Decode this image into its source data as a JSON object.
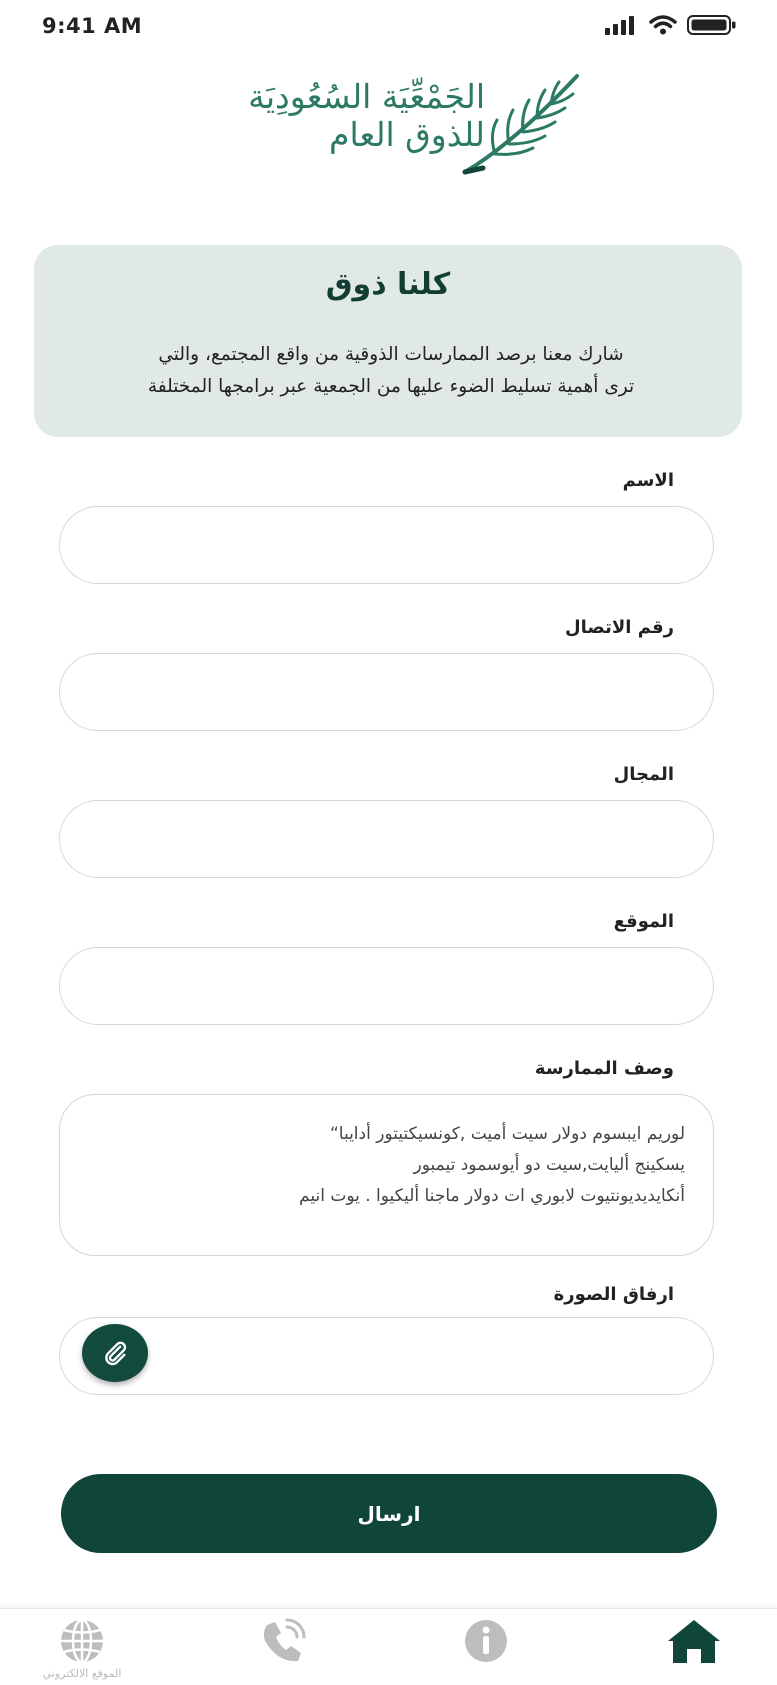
{
  "status_bar": {
    "time": "9:41 AM"
  },
  "logo": {
    "line1": "الجَمْعِّيَة السُعُودِيَة",
    "line2": "للذوق العام"
  },
  "intro": {
    "title": "كلنا ذوق",
    "line1": "شارك معنا برصد الممارسات الذوقية من واقع المجتمع، والتي",
    "line2": "ترى أهمية تسليط الضوء عليها من الجمعية عبر برامجها المختلفة"
  },
  "form": {
    "name_label": "الاسم",
    "phone_label": "رقم الاتصال",
    "field_label": "المجال",
    "location_label": "الموقع",
    "description_label": "وصف الممارسة",
    "description_lines": [
      "لوريم ايبسوم دولار سيت أميت ,كونسيكتيتور أدايبا“",
      "يسكينج أليايت,سيت دو أيوسمود تيمبور",
      "أنكايديديونتيوت لابوري ات دولار ماجنا أليكيوا . يوت انيم"
    ],
    "image_label": "ارفاق الصورة",
    "submit_label": "ارسال"
  },
  "tab_bar": {
    "items": [
      {
        "name": "website",
        "label": "الموقع الالكتروني",
        "icon": "globe-icon",
        "active": false
      },
      {
        "name": "contact",
        "label": "",
        "icon": "phone-icon",
        "active": false
      },
      {
        "name": "about",
        "label": "",
        "icon": "info-icon",
        "active": false
      },
      {
        "name": "home",
        "label": "",
        "icon": "home-icon",
        "active": true
      }
    ]
  },
  "colors": {
    "primary": "#0f4639",
    "card": "#e1e9e6",
    "logo": "#2c7a66",
    "inactive_icon": "#bdbdbd"
  }
}
